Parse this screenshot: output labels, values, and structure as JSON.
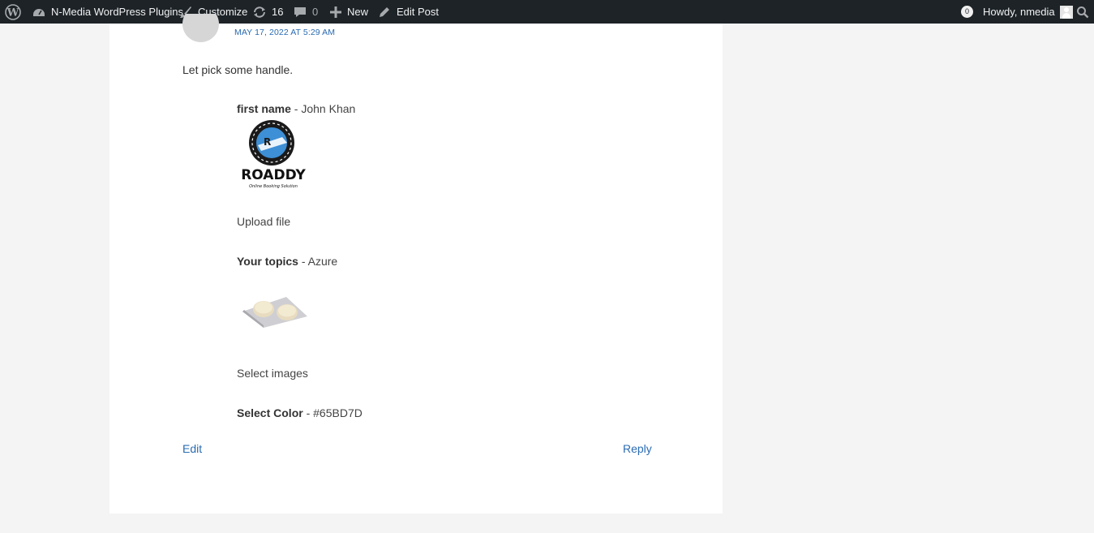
{
  "adminbar": {
    "site_name": "N-Media WordPress Plugins",
    "customize": "Customize",
    "updates_count": "16",
    "comments_count": "0",
    "new_label": "New",
    "edit_post": "Edit Post",
    "notifications_count": "0",
    "howdy": "Howdy, nmedia"
  },
  "comment": {
    "date": "MAY 17, 2022 AT 5:29 AM",
    "text": "Let pick some handle.",
    "fields": [
      {
        "label": "first name",
        "value": " - John Khan"
      },
      {
        "label": "Upload file"
      },
      {
        "label": "Your topics",
        "value": " - Azure"
      },
      {
        "label": "Select images"
      },
      {
        "label": "Select Color",
        "value": " - #65BD7D"
      }
    ],
    "logo_text": "ROADDY",
    "logo_subtext": "Online Booking Solution",
    "edit_label": "Edit",
    "reply_label": "Reply"
  },
  "colors": {
    "adminbar_bg": "#1d2327",
    "link": "#2a6bb2",
    "page_bg": "#f4f4f4",
    "card_bg": "#ffffff"
  },
  "icons": [
    "wordpress-icon",
    "dashboard-icon",
    "brush-icon",
    "updates-icon",
    "comment-icon",
    "plus-icon",
    "pencil-icon",
    "search-icon"
  ]
}
